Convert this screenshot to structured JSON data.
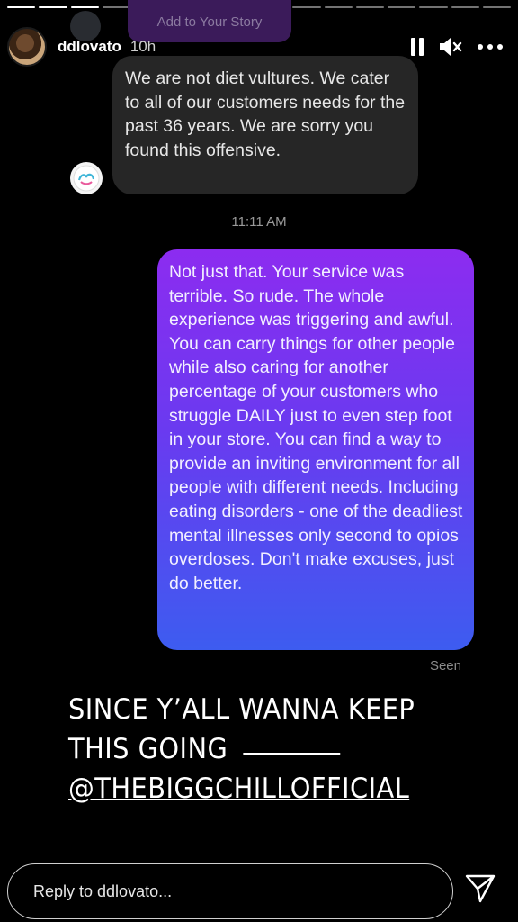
{
  "story": {
    "progress_segments": [
      true,
      true,
      true,
      false,
      false,
      false,
      false,
      false,
      false,
      false,
      false,
      false,
      false,
      false,
      false,
      false
    ],
    "add_to_story_label": "Add to Your Story"
  },
  "header": {
    "username": "ddlovato",
    "time_ago": "10h",
    "icons": [
      "pause-icon",
      "mute-icon",
      "more-icon"
    ]
  },
  "conversation": {
    "incoming_message": "We are not diet vultures. We cater to all of our customers needs for the past 36 years. We are sorry you found this offensive.",
    "timestamp": "11:11 AM",
    "outgoing_message": "Not just that. Your service was terrible. So rude. The whole experience was triggering and awful. You can carry things for other people while also caring for another percentage of your customers who struggle DAILY just to even step foot in your store. You can find a way to provide an inviting environment for all people with different needs. Including eating disorders - one of the deadliest mental illnesses only second to opios overdoses. Don't make excuses, just do better.",
    "seen_label": "Seen",
    "outgoing_gradient": [
      "#8c2cf0",
      "#3d5cf0"
    ]
  },
  "overlay": {
    "line1": "SINCE Y’ALL WANNA KEEP",
    "line2": "THIS GOING",
    "mention": "@THEBIGGCHILLOFFICIAL"
  },
  "reply": {
    "placeholder": "Reply to ddlovato...",
    "send_icon": "send-icon"
  }
}
